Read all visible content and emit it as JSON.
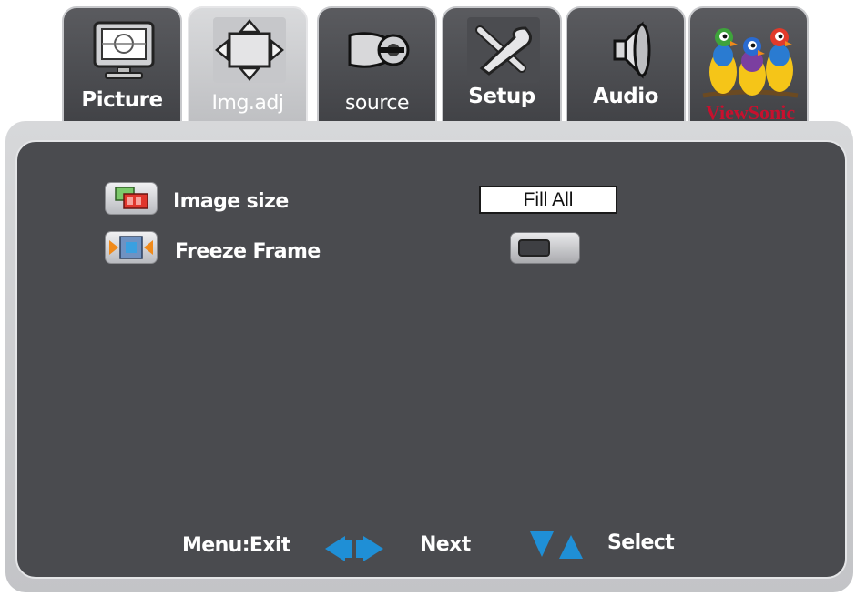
{
  "tabs": [
    {
      "label": "Picture",
      "icon": "picture-monitor-icon"
    },
    {
      "label": "Img.adj",
      "icon": "image-adjust-arrows-icon",
      "active": true
    },
    {
      "label": "source",
      "icon": "source-connector-icon"
    },
    {
      "label": "Setup",
      "icon": "setup-tools-icon"
    },
    {
      "label": "Audio",
      "icon": "audio-speaker-icon"
    },
    {
      "label": "ViewSonic",
      "icon": "viewsonic-birds-logo"
    }
  ],
  "menu": {
    "items": [
      {
        "label": "Image size",
        "value": "Fill All",
        "icon": "image-size-icon"
      },
      {
        "label": "Freeze Frame",
        "toggle_on": false,
        "icon": "freeze-frame-icon"
      }
    ]
  },
  "footer": {
    "exit": "Menu:Exit",
    "next": "Next",
    "select": "Select"
  },
  "colors": {
    "panel": "#4a4b4f",
    "tab": "#4c4d51",
    "tab_active": "#cfd0d2",
    "arrow_blue": "#1f8fd6"
  }
}
